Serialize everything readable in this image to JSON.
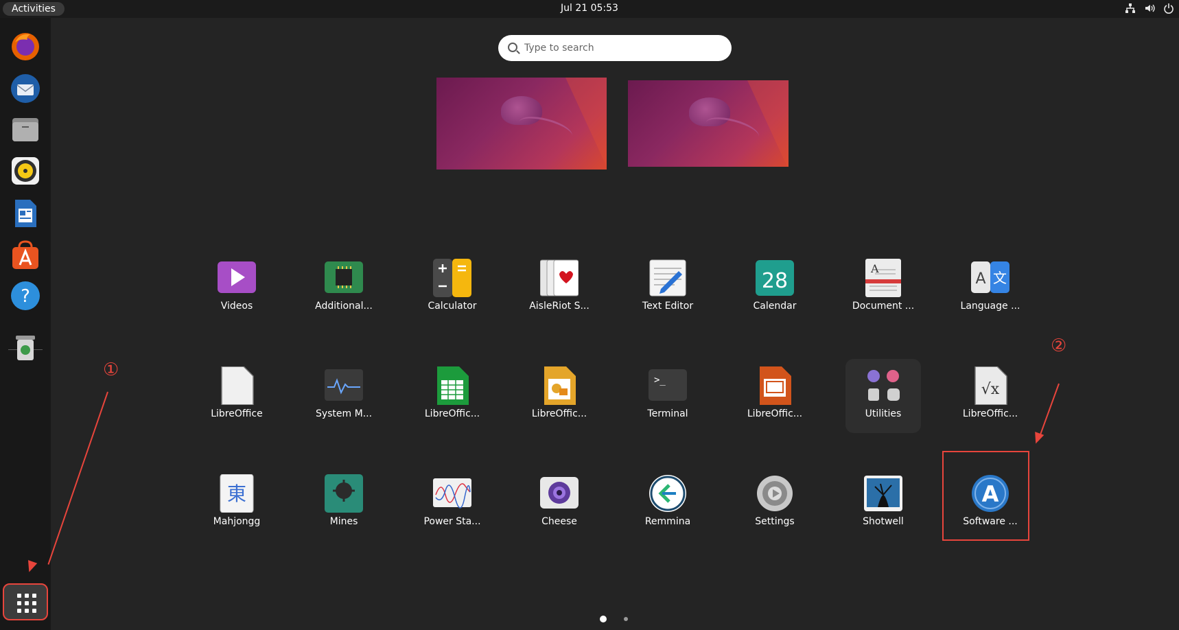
{
  "topbar": {
    "activities_label": "Activities",
    "clock": "Jul 21  05:53",
    "tray_icons": [
      "network-icon",
      "volume-icon",
      "power-icon"
    ]
  },
  "dock": {
    "items": [
      {
        "name": "firefox",
        "icon": "firefox-icon",
        "color": "#e66000"
      },
      {
        "name": "thunderbird",
        "icon": "thunderbird-icon",
        "color": "#2a71c9"
      },
      {
        "name": "files",
        "icon": "files-icon",
        "color": "#a3a3a3"
      },
      {
        "name": "rhythmbox",
        "icon": "rhythmbox-icon",
        "color": "#f6c915"
      },
      {
        "name": "libreoffice-writer",
        "icon": "writer-icon",
        "color": "#2a6fbe"
      },
      {
        "name": "ubuntu-software",
        "icon": "software-icon",
        "color": "#e95420"
      },
      {
        "name": "help",
        "icon": "help-icon",
        "color": "#2d8fdc"
      },
      {
        "name": "trash",
        "icon": "trash-icon",
        "color": "#cfcfcf"
      }
    ],
    "show_apps_icon": "grid-icon"
  },
  "search": {
    "placeholder": "Type to search"
  },
  "apps": [
    {
      "label": "Videos",
      "icon": "videos-icon",
      "color": "#a74ec6"
    },
    {
      "label": "Additional...",
      "icon": "chip-icon",
      "color": "#2f8a4e"
    },
    {
      "label": "Calculator",
      "icon": "calculator-icon",
      "color": "#3c3c3c"
    },
    {
      "label": "AisleRiot S...",
      "icon": "cards-icon",
      "color": "#f2f2f2"
    },
    {
      "label": "Text Editor",
      "icon": "text-editor-icon",
      "color": "#f4f4f4"
    },
    {
      "label": "Calendar",
      "icon": "calendar-icon",
      "color": "#1f9e8e",
      "text": "28"
    },
    {
      "label": "Document ...",
      "icon": "document-viewer-icon",
      "color": "#ececec"
    },
    {
      "label": "Language ...",
      "icon": "language-icon",
      "color": "#3584e4"
    },
    {
      "label": "LibreOffice",
      "icon": "libreoffice-icon",
      "color": "#f0f0f0"
    },
    {
      "label": "System M...",
      "icon": "system-monitor-icon",
      "color": "#3a3a3a"
    },
    {
      "label": "LibreOffic...",
      "icon": "calc-icon",
      "color": "#1c9b3c"
    },
    {
      "label": "LibreOffic...",
      "icon": "draw-icon",
      "color": "#e4a52a"
    },
    {
      "label": "Terminal",
      "icon": "terminal-icon",
      "color": "#3c3c3c",
      "text": ">_"
    },
    {
      "label": "LibreOffic...",
      "icon": "impress-icon",
      "color": "#d2541b"
    },
    {
      "label": "Utilities",
      "icon": "folder-icon",
      "color": "#2e2e2e",
      "folder": true
    },
    {
      "label": "LibreOffic...",
      "icon": "math-icon",
      "color": "#eaeaea"
    },
    {
      "label": "Mahjongg",
      "icon": "mahjongg-icon",
      "color": "#f4f4f4",
      "text": "東"
    },
    {
      "label": "Mines",
      "icon": "mines-icon",
      "color": "#2a8c78"
    },
    {
      "label": "Power Sta...",
      "icon": "power-stats-icon",
      "color": "#f0f0f0"
    },
    {
      "label": "Cheese",
      "icon": "cheese-icon",
      "color": "#e8e8e8"
    },
    {
      "label": "Remmina",
      "icon": "remmina-icon",
      "color": "#ffffff"
    },
    {
      "label": "Settings",
      "icon": "settings-icon",
      "color": "#9a9a9a"
    },
    {
      "label": "Shotwell",
      "icon": "shotwell-icon",
      "color": "#2b6fa8"
    },
    {
      "label": "Software ...",
      "icon": "software-icon",
      "color": "#2a78c8",
      "text": "A"
    }
  ],
  "annotations": {
    "step1": "①",
    "step2": "②"
  },
  "pagination": {
    "pages": 2,
    "current": 1
  }
}
